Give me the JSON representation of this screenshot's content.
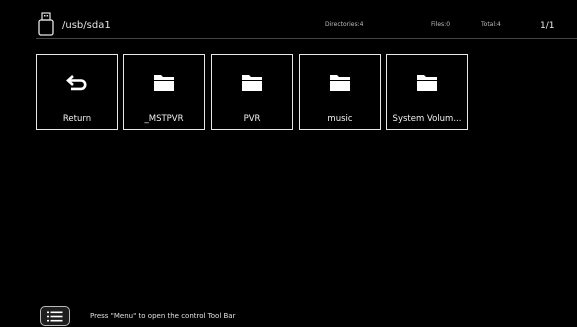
{
  "header": {
    "usb_icon": "usb-drive-icon",
    "path": "/usb/sda1",
    "directories": "Directories:4",
    "files": "Files:0",
    "total": "Total:4",
    "page": "1/1"
  },
  "items": [
    {
      "label": "Return",
      "icon": "return-arrow-icon"
    },
    {
      "label": "_MSTPVR",
      "icon": "folder-icon"
    },
    {
      "label": "PVR",
      "icon": "folder-icon"
    },
    {
      "label": "music",
      "icon": "folder-icon"
    },
    {
      "label": "System Volum...",
      "icon": "folder-icon"
    }
  ],
  "footer": {
    "menu_icon": "menu-list-icon",
    "hint": "Press \"Menu\" to open the control Tool Bar"
  }
}
